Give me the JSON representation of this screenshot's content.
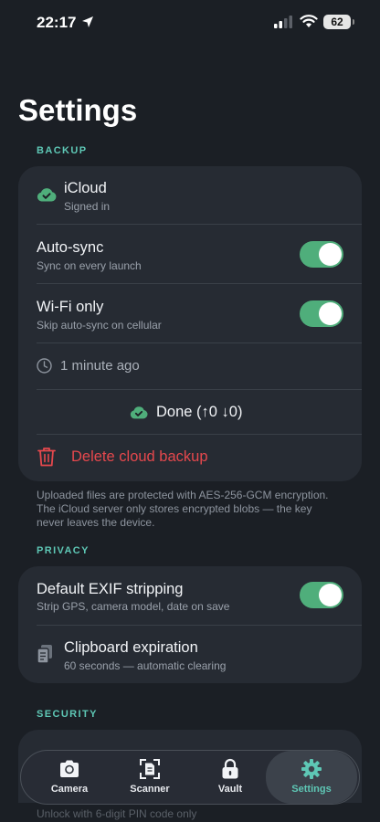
{
  "status_bar": {
    "time": "22:17",
    "battery": "62"
  },
  "page_title": "Settings",
  "backup": {
    "section_label": "BACKUP",
    "icloud": {
      "title": "iCloud",
      "subtitle": "Signed in"
    },
    "auto_sync": {
      "title": "Auto-sync",
      "subtitle": "Sync on every launch",
      "enabled": true
    },
    "wifi_only": {
      "title": "Wi-Fi only",
      "subtitle": "Skip auto-sync on cellular",
      "enabled": true
    },
    "last_sync": "1 minute ago",
    "sync_status": "Done (↑0 ↓0)",
    "delete_label": "Delete cloud backup",
    "footnote": "Uploaded files are protected with AES-256-GCM encryption. The iCloud server only stores encrypted blobs — the key never leaves the device."
  },
  "privacy": {
    "section_label": "PRIVACY",
    "exif": {
      "title": "Default EXIF stripping",
      "subtitle": "Strip GPS, camera model, date on save",
      "enabled": true
    },
    "clipboard": {
      "title": "Clipboard expiration",
      "subtitle": "60 seconds — automatic clearing"
    }
  },
  "security": {
    "section_label": "SECURITY",
    "partial_text": "Unlock with 6-digit PIN code only"
  },
  "tabs": [
    {
      "label": "Camera",
      "icon": "camera-icon",
      "active": false
    },
    {
      "label": "Scanner",
      "icon": "scanner-icon",
      "active": false
    },
    {
      "label": "Vault",
      "icon": "lock-icon",
      "active": false
    },
    {
      "label": "Settings",
      "icon": "gear-icon",
      "active": true
    }
  ],
  "colors": {
    "accent": "#5ec7b5",
    "toggle_on": "#4fae7b",
    "danger": "#e5484d",
    "background": "#1b1f25",
    "card": "#262b33"
  }
}
